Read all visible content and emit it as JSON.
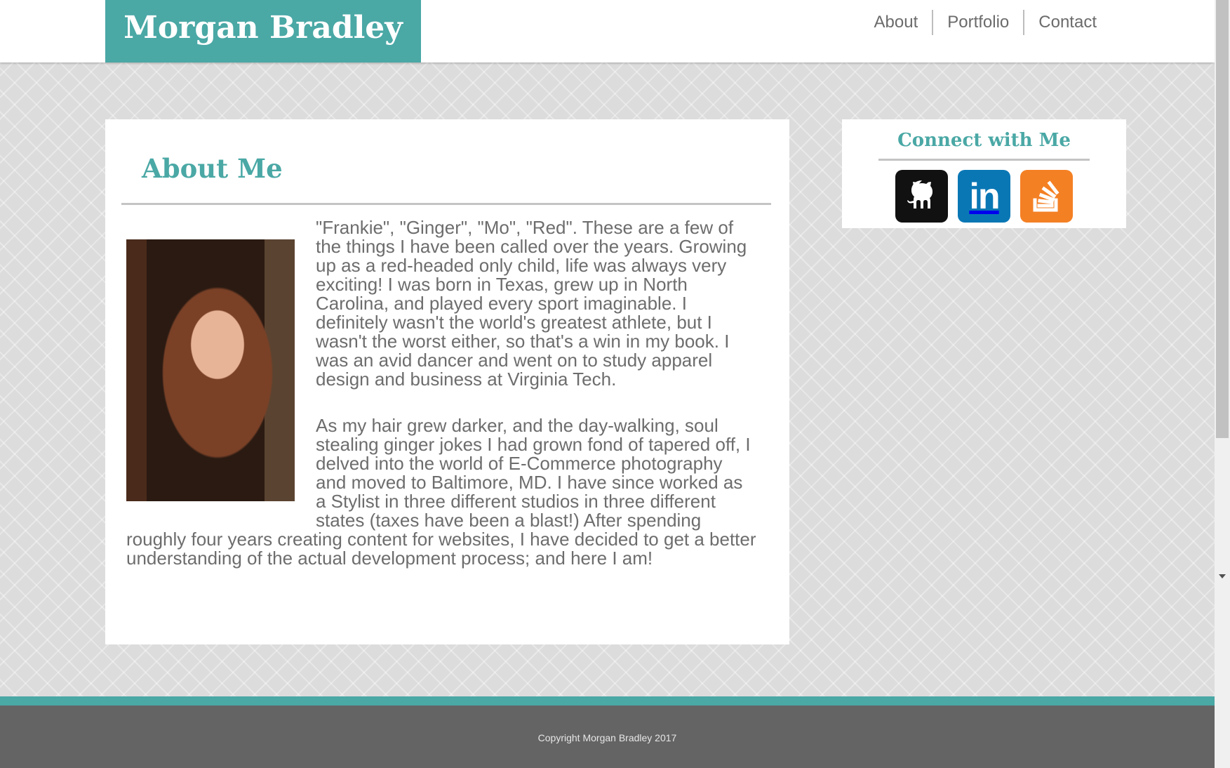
{
  "header": {
    "logo": "Morgan Bradley",
    "nav": [
      "About",
      "Portfolio",
      "Contact"
    ]
  },
  "about": {
    "title": "About Me",
    "paragraphs": [
      "\"Frankie\", \"Ginger\", \"Mo\", \"Red\". These are a few of the things I have been called over the years. Growing up as a red-headed only child, life was always very exciting! I was born in Texas, grew up in North Carolina, and played every sport imaginable. I definitely wasn't the world's greatest athlete, but I wasn't the worst either, so that's a win in my book. I was an avid dancer and went on to study apparel design and business at Virginia Tech.",
      "As my hair grew darker, and the day-walking, soul stealing ginger jokes I had grown fond of tapered off, I delved into the world of E-Commerce photography and moved to Baltimore, MD. I have since worked as a Stylist in three different studios in three different states (taxes have been a blast!) After spending roughly four years creating content for websites, I have decided to get a better understanding of the actual development process; and here I am!"
    ]
  },
  "connect": {
    "title": "Connect with Me",
    "icons": [
      "github-icon",
      "linkedin-icon",
      "stackoverflow-icon"
    ],
    "linkedin_glyph": "in"
  },
  "footer": {
    "copyright": "Copyright Morgan Bradley 2017"
  },
  "colors": {
    "accent": "#4aa8a5",
    "footer": "#646464",
    "github": "#111111",
    "linkedin": "#0a77b5",
    "stackoverflow": "#f48024"
  }
}
